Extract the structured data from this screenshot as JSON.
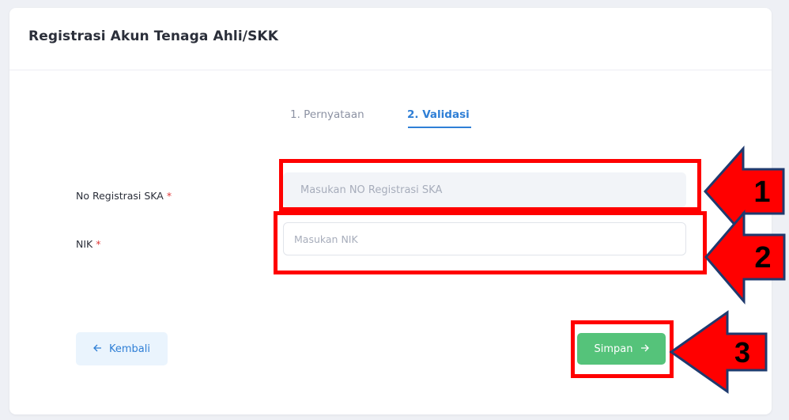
{
  "page": {
    "title": "Registrasi Akun Tenaga Ahli/SKK"
  },
  "tabs": [
    {
      "label": "1. Pernyataan",
      "active": false
    },
    {
      "label": "2. Validasi",
      "active": true
    }
  ],
  "form": {
    "ska": {
      "label": "No Registrasi SKA",
      "required_mark": "*",
      "placeholder": "Masukan NO Registrasi SKA",
      "value": ""
    },
    "nik": {
      "label": "NIK",
      "required_mark": "*",
      "placeholder": "Masukan NIK",
      "value": ""
    }
  },
  "buttons": {
    "back_label": "Kembali",
    "back_icon": "arrow-left-icon",
    "save_label": "Simpan",
    "save_icon": "arrow-right-icon"
  },
  "annotations": [
    {
      "number": "1"
    },
    {
      "number": "2"
    },
    {
      "number": "3"
    }
  ],
  "colors": {
    "accent": "#2f7fd6",
    "success": "#55c37a",
    "annotation": "#ff0000",
    "required": "#e03a3a"
  }
}
